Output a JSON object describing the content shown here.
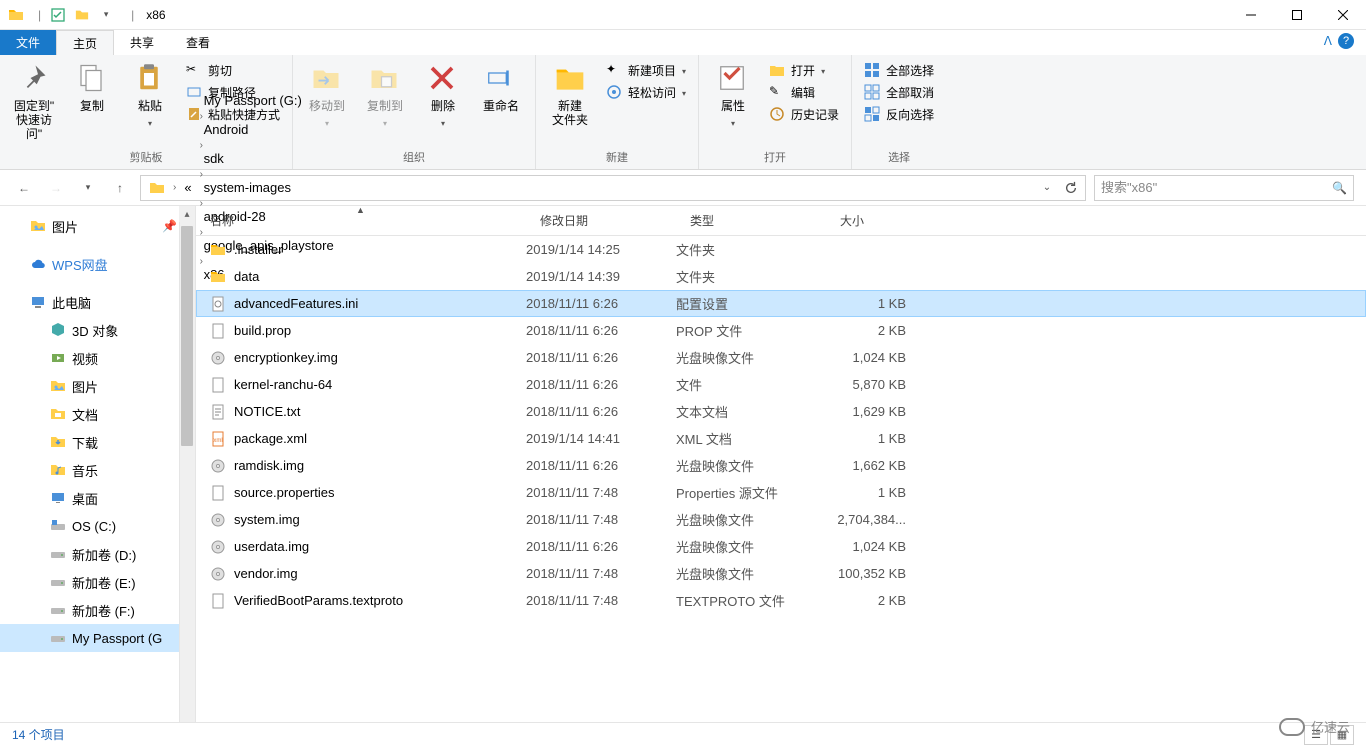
{
  "window": {
    "title": "x86"
  },
  "tabs": {
    "file": "文件",
    "home": "主页",
    "share": "共享",
    "view": "查看"
  },
  "ribbon": {
    "clipboard": {
      "label": "剪贴板",
      "pin": "固定到\"\n快速访问\"",
      "copy": "复制",
      "paste": "粘贴",
      "cut": "剪切",
      "copypath": "复制路径",
      "pasteshortcut": "粘贴快捷方式"
    },
    "organize": {
      "label": "组织",
      "moveto": "移动到",
      "copyto": "复制到",
      "delete": "删除",
      "rename": "重命名"
    },
    "new": {
      "label": "新建",
      "newfolder": "新建\n文件夹",
      "newitem": "新建项目",
      "easyaccess": "轻松访问"
    },
    "open": {
      "label": "打开",
      "properties": "属性",
      "open": "打开",
      "edit": "编辑",
      "history": "历史记录"
    },
    "select": {
      "label": "选择",
      "selectall": "全部选择",
      "selectnone": "全部取消",
      "invert": "反向选择"
    }
  },
  "breadcrumb": [
    "My Passport (G:)",
    "Android",
    "sdk",
    "system-images",
    "android-28",
    "google_apis_playstore",
    "x86"
  ],
  "search": {
    "placeholder": "搜索\"x86\""
  },
  "sidebar": {
    "items": [
      {
        "label": "图片",
        "icon": "pictures",
        "pin": true,
        "level": 1
      },
      {
        "spacer": true
      },
      {
        "label": "WPS网盘",
        "icon": "cloud",
        "level": 1,
        "color": "#2e7cd6"
      },
      {
        "spacer": true
      },
      {
        "label": "此电脑",
        "icon": "pc",
        "level": 1
      },
      {
        "label": "3D 对象",
        "icon": "3d",
        "level": 2
      },
      {
        "label": "视频",
        "icon": "video",
        "level": 2
      },
      {
        "label": "图片",
        "icon": "pictures",
        "level": 2
      },
      {
        "label": "文档",
        "icon": "docs",
        "level": 2
      },
      {
        "label": "下载",
        "icon": "download",
        "level": 2
      },
      {
        "label": "音乐",
        "icon": "music",
        "level": 2
      },
      {
        "label": "桌面",
        "icon": "desktop",
        "level": 2
      },
      {
        "label": "OS (C:)",
        "icon": "drive-win",
        "level": 2
      },
      {
        "label": "新加卷 (D:)",
        "icon": "drive",
        "level": 2
      },
      {
        "label": "新加卷 (E:)",
        "icon": "drive",
        "level": 2
      },
      {
        "label": "新加卷 (F:)",
        "icon": "drive",
        "level": 2
      },
      {
        "label": "My Passport (G",
        "icon": "drive",
        "level": 2,
        "selected": true
      }
    ]
  },
  "columns": {
    "name": "名称",
    "date": "修改日期",
    "type": "类型",
    "size": "大小"
  },
  "files": [
    {
      "name": ".installer",
      "date": "2019/1/14 14:25",
      "type": "文件夹",
      "size": "",
      "icon": "folder"
    },
    {
      "name": "data",
      "date": "2019/1/14 14:39",
      "type": "文件夹",
      "size": "",
      "icon": "folder"
    },
    {
      "name": "advancedFeatures.ini",
      "date": "2018/11/11 6:26",
      "type": "配置设置",
      "size": "1 KB",
      "icon": "ini",
      "selected": true
    },
    {
      "name": "build.prop",
      "date": "2018/11/11 6:26",
      "type": "PROP 文件",
      "size": "2 KB",
      "icon": "file"
    },
    {
      "name": "encryptionkey.img",
      "date": "2018/11/11 6:26",
      "type": "光盘映像文件",
      "size": "1,024 KB",
      "icon": "disc"
    },
    {
      "name": "kernel-ranchu-64",
      "date": "2018/11/11 6:26",
      "type": "文件",
      "size": "5,870 KB",
      "icon": "file"
    },
    {
      "name": "NOTICE.txt",
      "date": "2018/11/11 6:26",
      "type": "文本文档",
      "size": "1,629 KB",
      "icon": "txt"
    },
    {
      "name": "package.xml",
      "date": "2019/1/14 14:41",
      "type": "XML 文档",
      "size": "1 KB",
      "icon": "xml"
    },
    {
      "name": "ramdisk.img",
      "date": "2018/11/11 6:26",
      "type": "光盘映像文件",
      "size": "1,662 KB",
      "icon": "disc"
    },
    {
      "name": "source.properties",
      "date": "2018/11/11 7:48",
      "type": "Properties 源文件",
      "size": "1 KB",
      "icon": "file"
    },
    {
      "name": "system.img",
      "date": "2018/11/11 7:48",
      "type": "光盘映像文件",
      "size": "2,704,384...",
      "icon": "disc"
    },
    {
      "name": "userdata.img",
      "date": "2018/11/11 6:26",
      "type": "光盘映像文件",
      "size": "1,024 KB",
      "icon": "disc"
    },
    {
      "name": "vendor.img",
      "date": "2018/11/11 7:48",
      "type": "光盘映像文件",
      "size": "100,352 KB",
      "icon": "disc"
    },
    {
      "name": "VerifiedBootParams.textproto",
      "date": "2018/11/11 7:48",
      "type": "TEXTPROTO 文件",
      "size": "2 KB",
      "icon": "file"
    }
  ],
  "status": {
    "count": "14 个项目"
  },
  "watermark": "亿速云"
}
